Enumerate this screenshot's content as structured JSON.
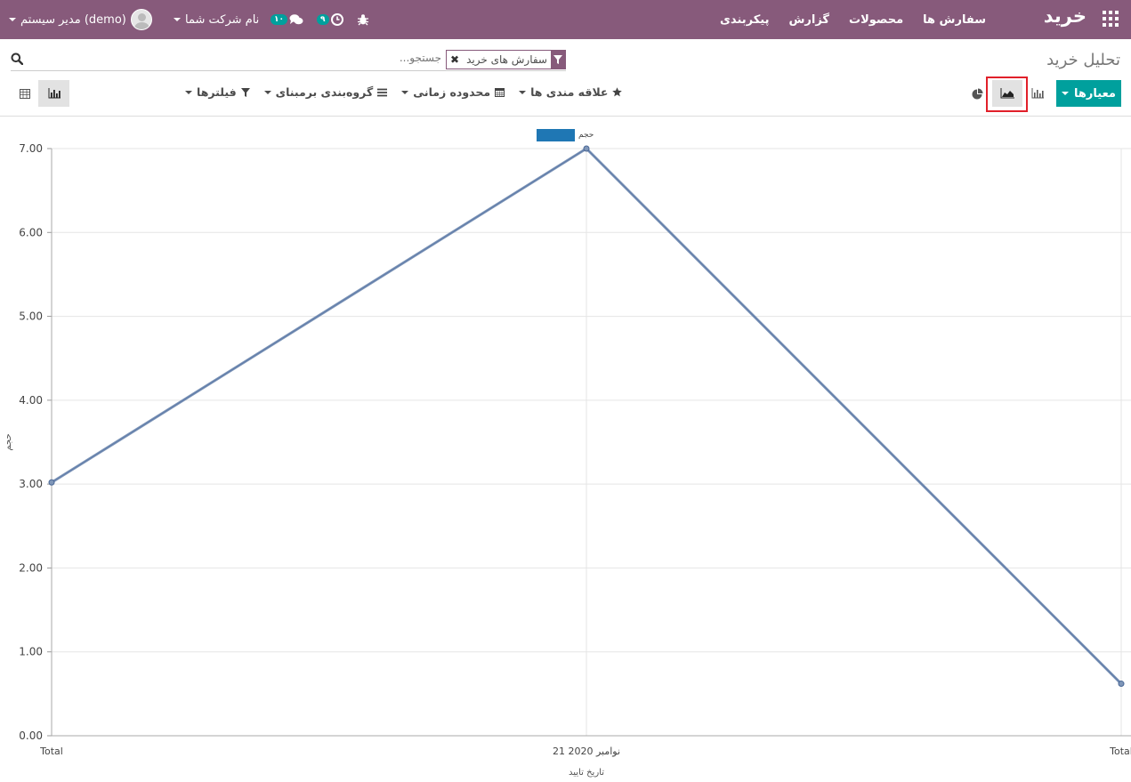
{
  "navbar": {
    "brand": "خرید",
    "menu": [
      "سفارش ها",
      "محصولات",
      "گزارش",
      "پیکربندی"
    ],
    "user": "مدیر سیستم (demo)",
    "company": "نام شرکت شما",
    "messages_count": "۱۰",
    "activities_count": "۹"
  },
  "page": {
    "title": "تحلیل خرید"
  },
  "search": {
    "facet_label": "سفارش های خرید",
    "placeholder": "جستجو..."
  },
  "toolbar": {
    "measures_label": "معیارها",
    "filters_label": "فیلترها",
    "groupby_label": "گروه‌بندی برمبنای",
    "timerange_label": "محدوده زمانی",
    "favorites_label": "علاقه مندی ها"
  },
  "colors": {
    "navbar": "#875a7b",
    "primary": "#00a09d",
    "series": "#1f77b4",
    "highlight": "#e1202a"
  },
  "chart_data": {
    "type": "line",
    "categories": [
      "Total",
      "21 نوامبر 2020",
      "Total"
    ],
    "series": [
      {
        "name": "حجم",
        "values": [
          3.02,
          7.0,
          0.62
        ]
      }
    ],
    "xlabel": "تاریخ تایید",
    "ylabel": "حجم",
    "ylim": [
      0,
      7
    ],
    "yticks": [
      "0.00",
      "1.00",
      "2.00",
      "3.00",
      "4.00",
      "5.00",
      "6.00",
      "7.00"
    ],
    "grid": true,
    "legend": "top-center"
  }
}
